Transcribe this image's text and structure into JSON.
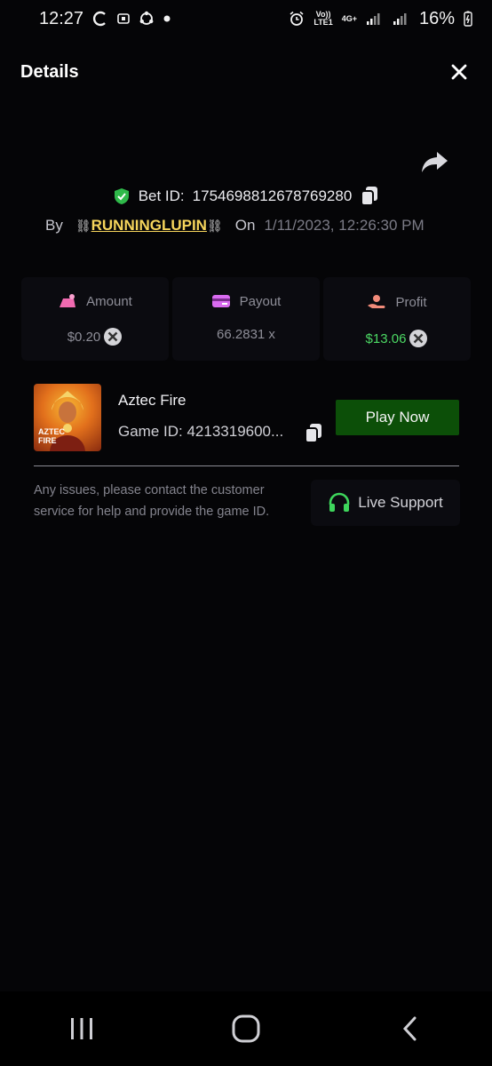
{
  "status_bar": {
    "time": "12:27",
    "net_top": "Vo))",
    "net_bottom": "LTE1",
    "signal_type": "4G+",
    "battery": "16%"
  },
  "header": {
    "title": "Details"
  },
  "bet": {
    "id_label": "Bet ID:",
    "id_value": "1754698812678769280",
    "by_label": "By",
    "username": "RUNNINGLUPIN",
    "on_label": "On",
    "datetime": "1/11/2023, 12:26:30 PM"
  },
  "stats": {
    "amount": {
      "label": "Amount",
      "value": "$0.20"
    },
    "payout": {
      "label": "Payout",
      "value": "66.2831 x"
    },
    "profit": {
      "label": "Profit",
      "value": "$13.06"
    }
  },
  "game": {
    "thumb_line1": "AZTEC",
    "thumb_line2": "FIRE",
    "name": "Aztec Fire",
    "id_text": "Game ID: 4213319600...",
    "play_label": "Play Now"
  },
  "support": {
    "text": "Any issues, please contact the customer service for help and provide the game ID.",
    "button_label": "Live Support"
  },
  "colors": {
    "accent_green": "#0c4f08",
    "profit_green": "#4cd964",
    "username_yellow": "#f6d55c"
  }
}
